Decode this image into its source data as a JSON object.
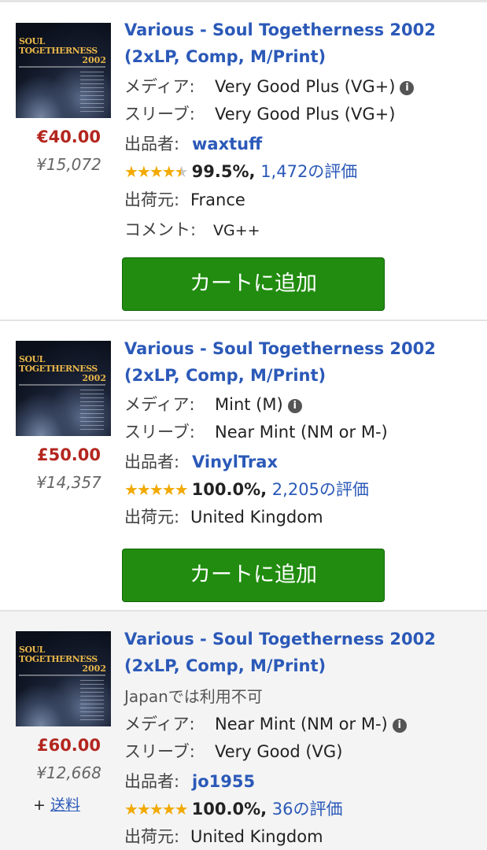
{
  "listings": [
    {
      "title": "Various - Soul Togetherness 2002 (2xLP, Comp, M/Print)",
      "cover": {
        "line1": "SOUL",
        "line2": "TOGETHERNESS",
        "line3": "2002"
      },
      "price": "€40.00",
      "price_converted": "¥15,072",
      "media_label": "メディア:",
      "media_value": "Very Good Plus (VG+)",
      "sleeve_label": "スリーブ:",
      "sleeve_value": "Very Good Plus (VG+)",
      "seller_label": "出品者:",
      "seller_name": "waxtuff",
      "rating_stars": 4.5,
      "rating_pct": "99.5%,",
      "rating_count": "1,472の評価",
      "ships_from_label": "出荷元:",
      "ships_from_value": "France",
      "comment_label": "コメント:",
      "comment_value": "VG++",
      "cart_button": "カートに追加"
    },
    {
      "title": "Various - Soul Togetherness 2002 (2xLP, Comp, M/Print)",
      "cover": {
        "line1": "SOUL",
        "line2": "TOGETHERNESS",
        "line3": "2002"
      },
      "price": "£50.00",
      "price_converted": "¥14,357",
      "media_label": "メディア:",
      "media_value": "Mint (M)",
      "sleeve_label": "スリーブ:",
      "sleeve_value": "Near Mint (NM or M-)",
      "seller_label": "出品者:",
      "seller_name": "VinylTrax",
      "rating_stars": 5,
      "rating_pct": "100.0%,",
      "rating_count": "2,205の評価",
      "ships_from_label": "出荷元:",
      "ships_from_value": "United Kingdom",
      "cart_button": "カートに追加"
    },
    {
      "title": "Various - Soul Togetherness 2002 (2xLP, Comp, M/Print)",
      "cover": {
        "line1": "SOUL",
        "line2": "TOGETHERNESS",
        "line3": "2002"
      },
      "price": "£60.00",
      "price_converted": "¥12,668",
      "shipping_prefix": "+",
      "shipping_link": "送料",
      "availability": "Japanでは利用不可",
      "media_label": "メディア:",
      "media_value": "Near Mint (NM or M-)",
      "sleeve_label": "スリーブ:",
      "sleeve_value": "Very Good (VG)",
      "seller_label": "出品者:",
      "seller_name": "jo1955",
      "rating_stars": 5,
      "rating_pct": "100.0%,",
      "rating_count": "36の評価",
      "ships_from_label": "出荷元:",
      "ships_from_value": "United Kingdom"
    }
  ],
  "icons": {
    "info": "info-circle-icon",
    "star": "star-icon"
  },
  "colors": {
    "link": "#2b59b8",
    "price": "#b3261e",
    "cart_button": "#218c0f",
    "star": "#f2a900"
  }
}
